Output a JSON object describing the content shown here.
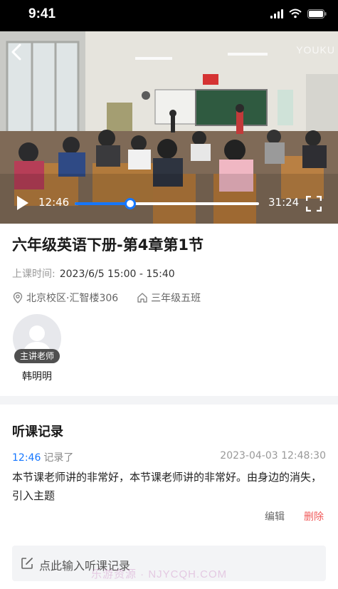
{
  "status_bar": {
    "time": "9:41"
  },
  "video": {
    "watermark": "YOUKU",
    "current_time": "12:46",
    "total_time": "31:24",
    "progress": 0.3
  },
  "lesson": {
    "title": "六年级英语下册-第4章第1节",
    "time_label": "上课时间:",
    "time_value": "2023/6/5  15:00 - 15:40",
    "location": "北京校区·汇智楼306",
    "class_name": "三年级五班"
  },
  "teacher": {
    "badge": "主讲老师",
    "name": "韩明明"
  },
  "records": {
    "title": "听课记录",
    "items": [
      {
        "timestamp": "12:46",
        "suffix": "记录了",
        "date": "2023-04-03  12:48:30",
        "content": "本节课老师讲的非常好，本节课老师讲的非常好。由身边的消失，引入主题",
        "edit_label": "编辑",
        "delete_label": "删除"
      }
    ],
    "input_placeholder": "点此输入听课记录"
  },
  "watermark_bottom": "乐游资源 · NJYCQH.COM",
  "colors": {
    "accent": "#1677ff",
    "danger": "#f05a5a"
  },
  "icons": [
    "back-icon",
    "play-icon",
    "fullscreen-icon",
    "location-pin-icon",
    "home-icon",
    "edit-icon",
    "user-icon",
    "signal-icon",
    "wifi-icon",
    "battery-icon"
  ]
}
